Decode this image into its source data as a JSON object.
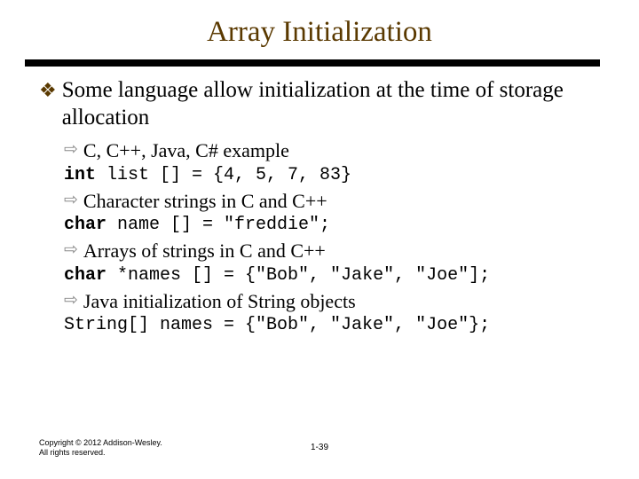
{
  "title": "Array Initialization",
  "bullet_main": "Some language allow initialization at the time of storage allocation",
  "items": [
    {
      "label": "C, C++, Java, C# example",
      "code_kw": "int",
      "code_rest": " list [] = {4, 5, 7, 83}"
    },
    {
      "label": "Character strings in C and C++",
      "code_kw": "char",
      "code_rest": " name [] = \"freddie\";"
    },
    {
      "label": "Arrays of strings in C and C++",
      "code_kw": "char",
      "code_rest": " *names [] = {\"Bob\", \"Jake\", \"Joe\"];"
    },
    {
      "label": "Java initialization of String objects",
      "code_kw": "",
      "code_rest": "String[] names = {\"Bob\", \"Jake\", \"Joe\"};"
    }
  ],
  "footer": "Copyright © 2012 Addison-Wesley. All rights reserved.",
  "page": "1-39",
  "markers": {
    "l1": "❖",
    "l2": "⇨"
  }
}
